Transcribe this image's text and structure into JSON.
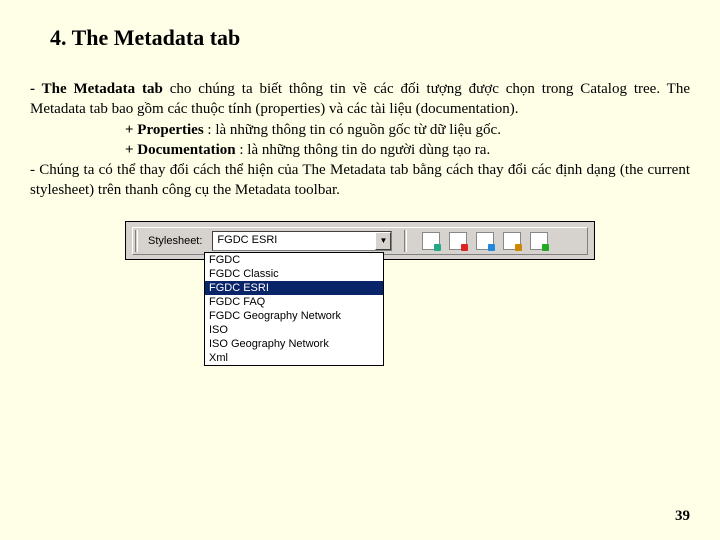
{
  "heading": "4. The Metadata tab",
  "para1_lead": "- The Metadata tab",
  "para1_rest": " cho chúng ta biết thông tin về các đối tượng được chọn trong Catalog tree. The Metadata tab bao gồm các thuộc tính (properties) và các tài liệu (documentation).",
  "prop_label": "+ Properties",
  "prop_rest": " : là những thông tin có nguồn gốc từ dữ liệu gốc.",
  "doc_label": "+ Documentation",
  "doc_rest": " : là những thông tin do người dùng tạo ra.",
  "para2": "- Chúng ta có thể thay đổi cách thể hiện của The Metadata tab bằng cách thay đổi các định dạng (the current stylesheet) trên thanh công cụ the Metadata toolbar.",
  "toolbar_label": "Stylesheet:",
  "combo_value": "FGDC ESRI",
  "options": [
    "FGDC",
    "FGDC Classic",
    "FGDC ESRI",
    "FGDC FAQ",
    "FGDC Geography Network",
    "ISO",
    "ISO Geography Network",
    "Xml"
  ],
  "selected_index": 2,
  "page_number": "39"
}
